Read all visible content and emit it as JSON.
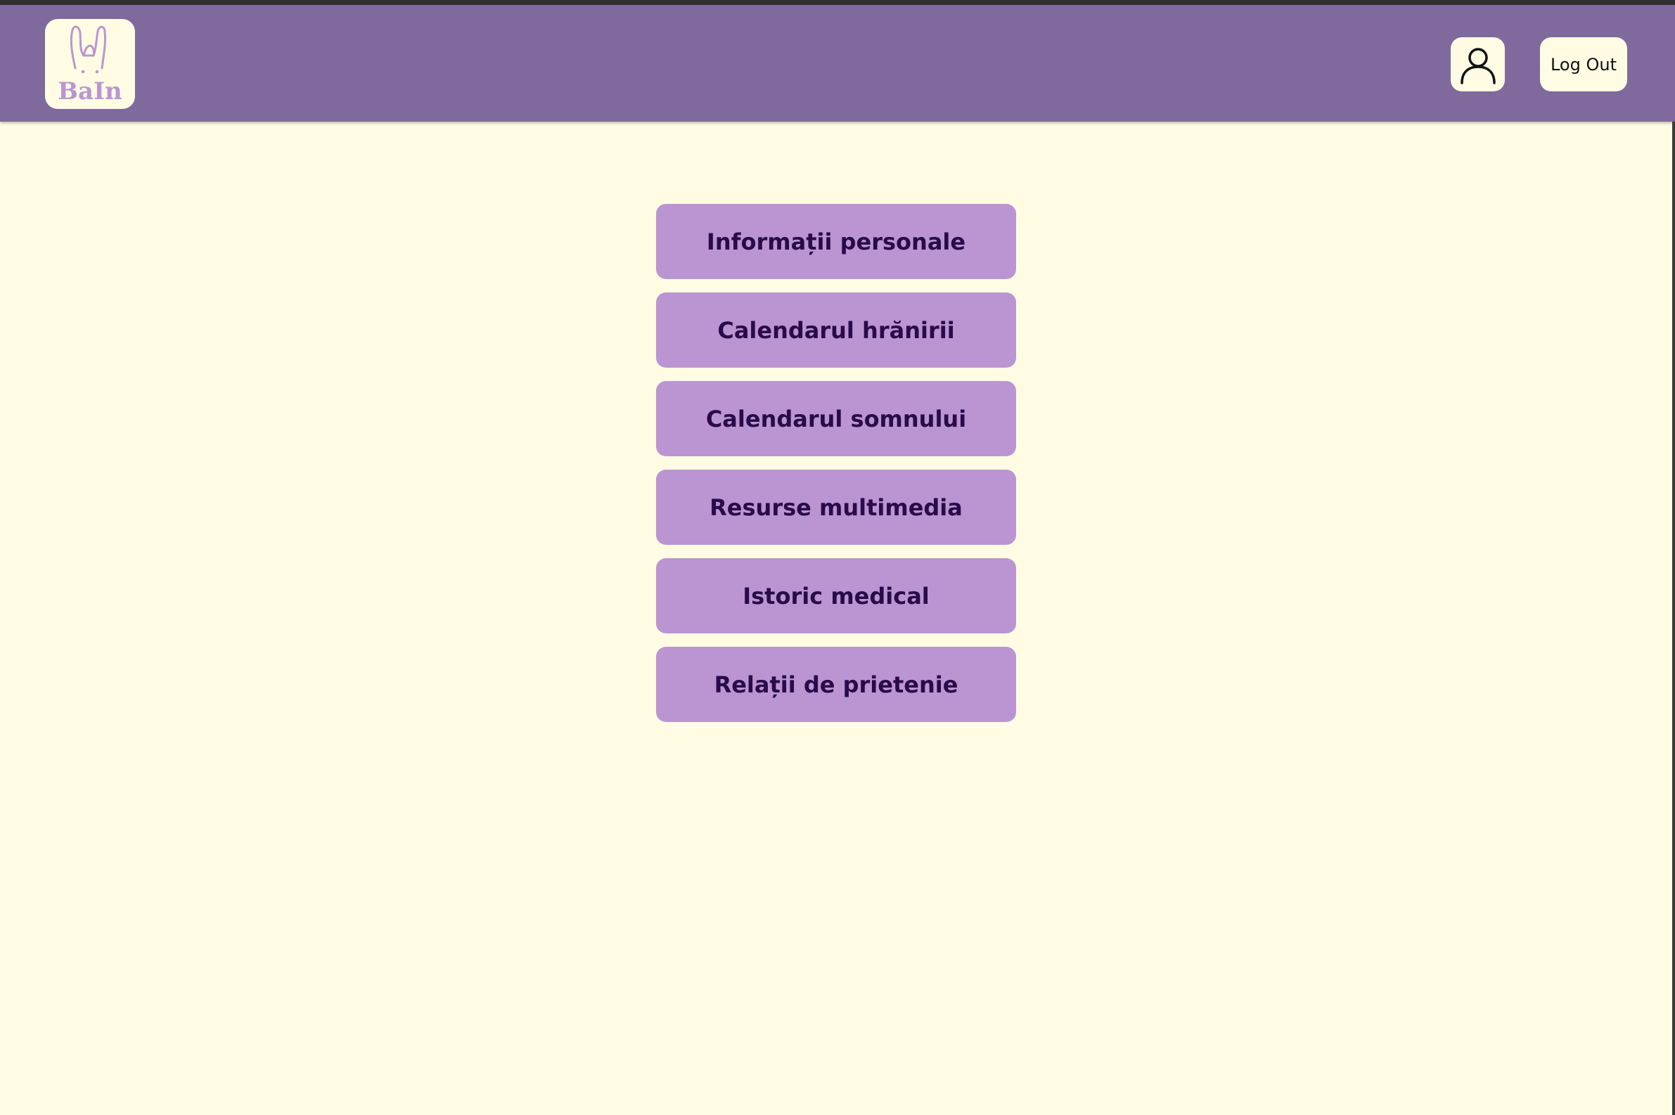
{
  "header": {
    "logo_text": "BaIn",
    "profile_icon": "user-icon",
    "logout_label": "Log Out"
  },
  "menu": {
    "items": [
      {
        "label": "Informații personale"
      },
      {
        "label": "Calendarul hrănirii"
      },
      {
        "label": "Calendarul somnului"
      },
      {
        "label": "Resurse multimedia"
      },
      {
        "label": "Istoric medical"
      },
      {
        "label": "Relații de prietenie"
      }
    ]
  },
  "colors": {
    "navbar": "#7F699D",
    "background": "#FFFCE3",
    "button": "#BA95D2",
    "button_text": "#2A0A4A",
    "logo_accent": "#BA95D2"
  }
}
